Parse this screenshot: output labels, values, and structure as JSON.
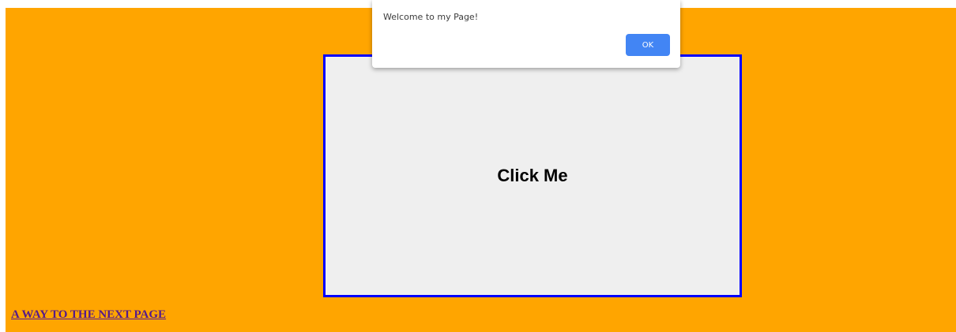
{
  "page": {
    "background_color": "#FFA500"
  },
  "click_box": {
    "label": "Click Me",
    "border_color": "#0000FF",
    "background_color": "#EFEFEF"
  },
  "next_link": {
    "text": "A WAY TO THE NEXT PAGE",
    "color": "#551A8B"
  },
  "alert": {
    "message": "Welcome to my Page!",
    "ok_label": "OK",
    "ok_color": "#4285F4"
  }
}
